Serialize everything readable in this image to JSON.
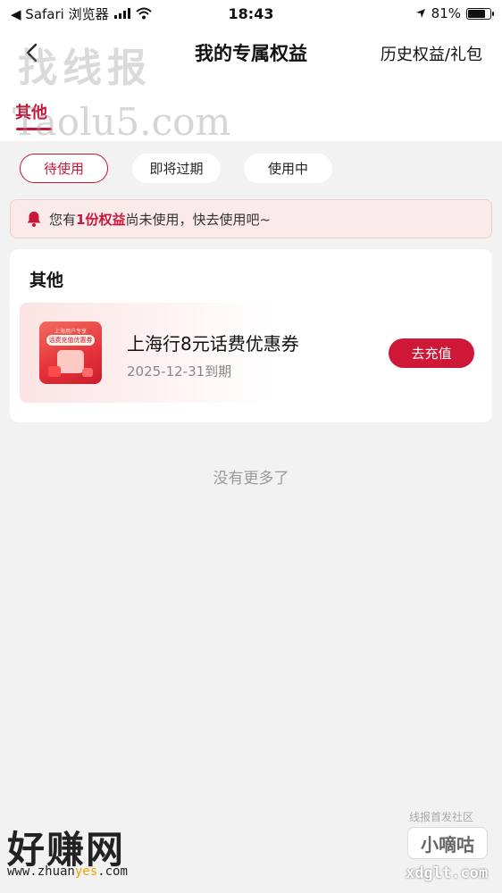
{
  "status_bar": {
    "back_app": "◀ Safari 浏览器",
    "time": "18:43",
    "battery_percent": "81%",
    "battery_level": 0.81
  },
  "nav": {
    "title": "我的专属权益",
    "history_label": "历史权益/礼包"
  },
  "watermarks": {
    "top_cn": "找线报",
    "top_url": "Taolu5.com",
    "bottom_left": "好赚网",
    "bottom_left_url_pre": "www.zhuan",
    "bottom_left_url_hl": "yes",
    "bottom_left_url_post": ".com",
    "bottom_right_top": "线报首发社区",
    "bottom_right_box": "小嘀咕",
    "bottom_right_url": "xdglt.com"
  },
  "category": {
    "active_tab": "其他"
  },
  "filters": [
    "待使用",
    "即将过期",
    "使用中"
  ],
  "notice": {
    "prefix": "您有",
    "highlight": "1份权益",
    "suffix": "尚未使用，快去使用吧~"
  },
  "card": {
    "section_title": "其他",
    "coupon": {
      "thumb_line1": "上海用户专享",
      "thumb_line2": "话费充值优惠券",
      "name": "上海行8元话费优惠券",
      "expiry": "2025-12-31到期",
      "action": "去充值"
    }
  },
  "footer_note": "没有更多了",
  "colors": {
    "accent": "#c8163a",
    "button": "#cf1737",
    "notice_bg": "#fbeaea",
    "page_bg": "#f2f2f2"
  }
}
